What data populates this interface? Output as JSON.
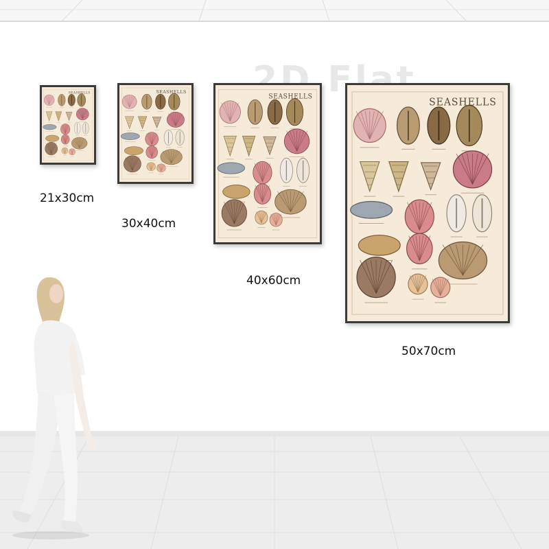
{
  "watermark": "2D Flat",
  "posters": [
    {
      "size": "21x30cm",
      "title": "SEASHELLS"
    },
    {
      "size": "30x40cm",
      "title": "SEASHELLS"
    },
    {
      "size": "40x60cm",
      "title": "SEASHELLS"
    },
    {
      "size": "50x70cm",
      "title": "SEASHELLS"
    }
  ],
  "colors": {
    "poster_bg": "#f6ead8",
    "frame": "#3a3a3a",
    "wall": "#ffffff",
    "floor": "#ededed"
  }
}
